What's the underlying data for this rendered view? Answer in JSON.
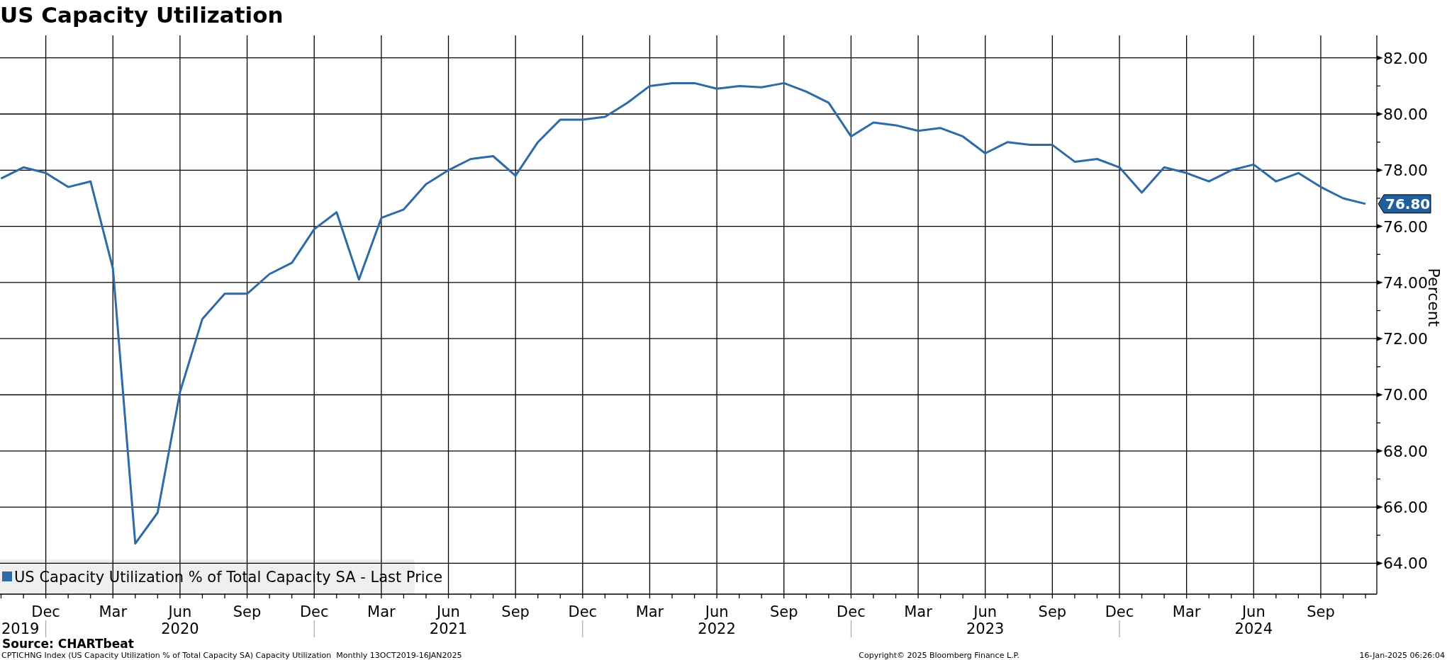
{
  "title": "US Capacity Utilization",
  "chart": {
    "chart_data": {
      "type": "line",
      "ylabel": "Percent",
      "grid": true,
      "categories": [
        null,
        null,
        "Dec",
        null,
        null,
        "Mar",
        null,
        null,
        "Jun",
        null,
        null,
        "Sep",
        null,
        null,
        "Dec",
        null,
        null,
        "Mar",
        null,
        null,
        "Jun",
        null,
        null,
        "Sep",
        null,
        null,
        "Dec",
        null,
        null,
        "Mar",
        null,
        null,
        "Jun",
        null,
        null,
        "Sep",
        null,
        null,
        "Dec",
        null,
        null,
        "Mar",
        null,
        null,
        "Jun",
        null,
        null,
        "Sep",
        null,
        null,
        "Dec",
        null,
        null,
        "Mar",
        null,
        null,
        "Jun",
        null,
        null,
        "Sep",
        null,
        null
      ],
      "series": [
        {
          "name": "US Capacity Utilization % of Total Capacity SA - Last Price",
          "color": "#2d6aa6",
          "values": [
            77.7,
            78.1,
            77.9,
            77.4,
            77.6,
            74.5,
            64.7,
            65.8,
            70.1,
            72.7,
            73.6,
            73.6,
            74.3,
            74.7,
            75.9,
            76.5,
            74.1,
            76.3,
            76.6,
            77.5,
            78.0,
            78.4,
            78.5,
            77.8,
            79.0,
            79.8,
            79.8,
            79.9,
            80.4,
            81.0,
            81.1,
            81.1,
            80.9,
            81.0,
            80.95,
            81.1,
            80.8,
            80.4,
            79.2,
            79.7,
            79.6,
            79.4,
            79.5,
            79.2,
            78.6,
            79.0,
            78.9,
            78.9,
            78.3,
            78.4,
            78.1,
            77.2,
            78.1,
            77.9,
            77.6,
            78.0,
            78.2,
            77.6,
            77.9,
            77.4,
            77.0,
            76.8
          ]
        }
      ],
      "ylim": [
        62.9,
        82.8
      ],
      "yticks": [
        {
          "value": 64,
          "label": "64.00"
        },
        {
          "value": 66,
          "label": "66.00"
        },
        {
          "value": 68,
          "label": "68.00"
        },
        {
          "value": 70,
          "label": "70.00"
        },
        {
          "value": 72,
          "label": "72.00"
        },
        {
          "value": 74,
          "label": "74.00"
        },
        {
          "value": 76,
          "label": "76.00"
        },
        {
          "value": 78,
          "label": "78.00"
        },
        {
          "value": 80,
          "label": "80.00"
        },
        {
          "value": 82,
          "label": "82.00"
        }
      ],
      "annotations": [
        "76.80"
      ]
    },
    "year_labels": [
      "2019",
      "2020",
      "2021",
      "2022",
      "2023",
      "2024"
    ]
  },
  "source": "Source: CHARTbeat",
  "footer": {
    "description": "CPTICHNG Index (US Capacity Utilization % of Total Capacity SA) Capacity Utilization  Monthly 13OCT2019-16JAN2025",
    "copyright": "Copyright© 2025 Bloomberg Finance L.P.",
    "timestamp": "16-Jan-2025 06:26:04"
  }
}
